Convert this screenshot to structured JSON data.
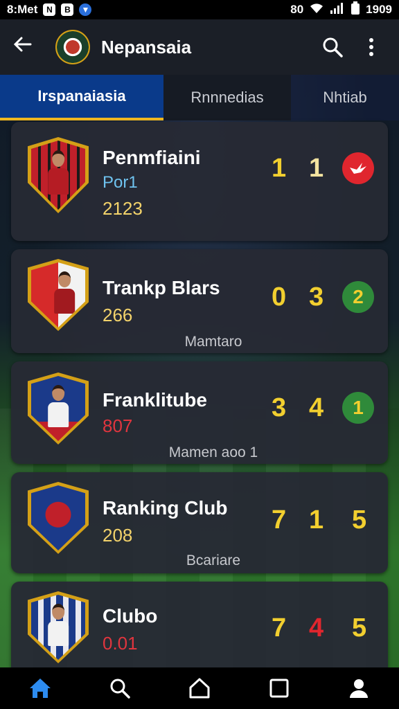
{
  "status_bar": {
    "left_text": "8:Met",
    "icon1": "N",
    "icon2": "B",
    "signal_text": "80",
    "time": "1909"
  },
  "app_bar": {
    "title": "Nepansaia"
  },
  "tabs": [
    {
      "label": "Irspanaiasia",
      "active": true
    },
    {
      "label": "Rnnnedias",
      "active": false
    },
    {
      "label": "Nhtiab",
      "active": false
    }
  ],
  "clubs": [
    {
      "name": "Penmfiaini",
      "sub": "Por1",
      "sub_color": "#6fc3f0",
      "year": "2123",
      "footer": "",
      "scores": [
        "1",
        "1"
      ],
      "badge_text": "",
      "badge_color": "#e0262e",
      "badge_icon": "bird-icon"
    },
    {
      "name": "Trankp Blars",
      "sub": "",
      "year": "266",
      "footer": "Mamtaro",
      "scores": [
        "0",
        "3"
      ],
      "badge_text": "2",
      "badge_color": "#2f8a3a"
    },
    {
      "name": "Franklitube",
      "sub": "",
      "year": "807",
      "footer": "Mamen aoo 1",
      "scores": [
        "3",
        "4"
      ],
      "badge_text": "1",
      "badge_color": "#2f8a3a"
    },
    {
      "name": "Ranking Club",
      "sub": "",
      "year": "208",
      "footer": "Bcariare",
      "scores": [
        "7",
        "1",
        "5"
      ]
    },
    {
      "name": "Clubo",
      "sub": "",
      "year": "0.01",
      "footer": "",
      "scores": [
        "7",
        "4",
        "5"
      ]
    }
  ],
  "icons": {
    "back": "back-arrow-icon",
    "search": "search-icon",
    "more": "more-vertical-icon"
  },
  "bottom_nav": [
    "home-icon",
    "search-icon",
    "house-outline-icon",
    "square-icon",
    "profile-icon"
  ],
  "colors": {
    "accent": "#f0b820",
    "tab_active": "#0a3a8a",
    "home_active": "#2d8cf0"
  }
}
